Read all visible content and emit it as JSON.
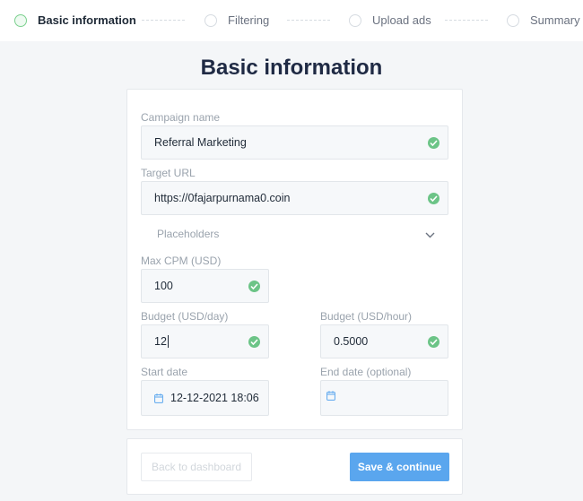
{
  "stepper": {
    "steps": [
      {
        "label": "Basic information",
        "active": true
      },
      {
        "label": "Filtering",
        "active": false
      },
      {
        "label": "Upload ads",
        "active": false
      },
      {
        "label": "Summary",
        "active": false
      }
    ]
  },
  "page": {
    "title": "Basic information"
  },
  "form": {
    "campaign_name": {
      "label": "Campaign name",
      "value": "Referral Marketing"
    },
    "target_url": {
      "label": "Target URL",
      "value": "https://0fajarpurnama0.coin"
    },
    "placeholders": {
      "label": "Placeholders"
    },
    "max_cpm": {
      "label": "Max CPM (USD)",
      "value": "100"
    },
    "budget_day": {
      "label": "Budget (USD/day)",
      "value": "12"
    },
    "budget_hour": {
      "label": "Budget (USD/hour)",
      "value": "0.5000"
    },
    "start_date": {
      "label": "Start date",
      "value": "12-12-2021 18:06"
    },
    "end_date": {
      "label": "End date (optional)",
      "value": ""
    }
  },
  "footer": {
    "back_label": "Back to dashboard",
    "save_label": "Save & continue"
  },
  "colors": {
    "accent": "#5aa6ee",
    "valid": "#6cc487",
    "active_step": "#7bd08e"
  }
}
